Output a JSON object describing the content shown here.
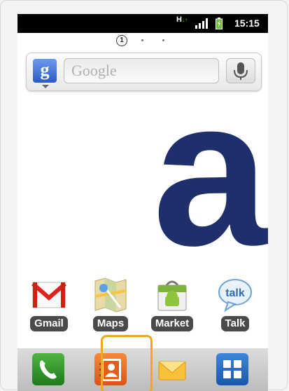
{
  "status_bar": {
    "network_type": "H",
    "time": "15:15"
  },
  "pager": {
    "current_page": "1"
  },
  "search_widget": {
    "logo_letter": "g",
    "placeholder": "Google"
  },
  "wallpaper": {
    "letter": "a",
    "color": "#1f2f6b"
  },
  "apps": [
    {
      "label": "Gmail"
    },
    {
      "label": "Maps"
    },
    {
      "label": "Market"
    },
    {
      "label": "Talk",
      "icon_text": "talk"
    }
  ],
  "dock": {
    "items": [
      "phone-icon",
      "contacts-icon",
      "messaging-icon",
      "app-drawer-icon"
    ],
    "highlight_color": "#f0a820"
  }
}
